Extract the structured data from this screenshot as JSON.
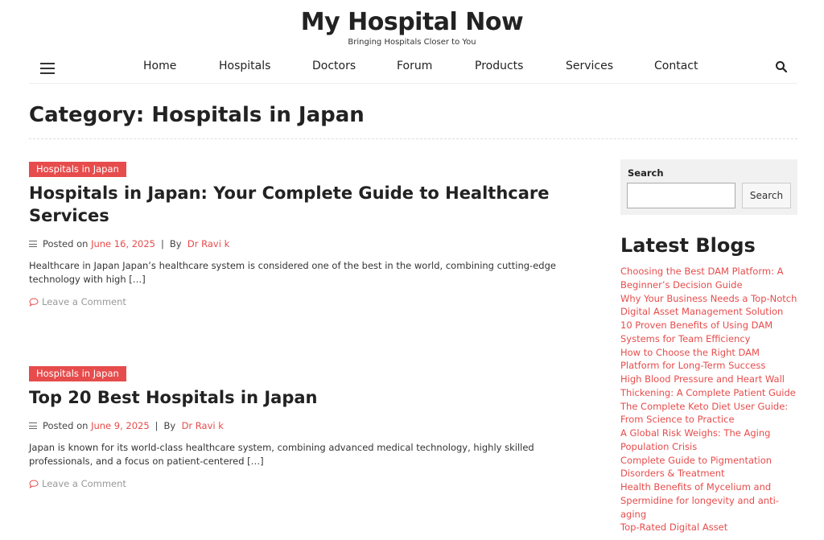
{
  "site": {
    "title": "My Hospital Now",
    "tagline": "Bringing Hospitals Closer to You"
  },
  "nav": {
    "items": [
      {
        "label": "Home"
      },
      {
        "label": "Hospitals"
      },
      {
        "label": "Doctors"
      },
      {
        "label": "Forum"
      },
      {
        "label": "Products"
      },
      {
        "label": "Services"
      },
      {
        "label": "Contact"
      }
    ],
    "menu_icon": "hamburger-icon",
    "search_icon": "search-icon"
  },
  "page": {
    "title": "Category: Hospitals in Japan"
  },
  "posts": [
    {
      "category": "Hospitals in Japan",
      "title": "Hospitals in Japan: Your Complete Guide to Healthcare Services",
      "posted_on_label": "Posted on",
      "date": "June 16, 2025",
      "by_label": "By",
      "author": "Dr Ravi k",
      "excerpt": "Healthcare in Japan Japan’s healthcare system is considered one of the best in the world, combining cutting-edge technology with high […]",
      "comment_label": "Leave a Comment"
    },
    {
      "category": "Hospitals in Japan",
      "title": "Top 20 Best Hospitals in Japan",
      "posted_on_label": "Posted on",
      "date": "June 9, 2025",
      "by_label": "By",
      "author": "Dr Ravi k",
      "excerpt": "Japan is known for its world-class healthcare system, combining advanced medical technology, highly skilled professionals, and a focus on patient-centered […]",
      "comment_label": "Leave a Comment"
    }
  ],
  "sidebar": {
    "search": {
      "label": "Search",
      "button_label": "Search",
      "value": "",
      "placeholder": ""
    },
    "latest_blogs": {
      "heading": "Latest Blogs",
      "items": [
        "Choosing the Best DAM Platform: A Beginner’s Decision Guide",
        "Why Your Business Needs a Top-Notch Digital Asset Management Solution",
        "10 Proven Benefits of Using DAM Systems for Team Efficiency",
        "How to Choose the Right DAM Platform for Long-Term Success",
        "High Blood Pressure and Heart Wall Thickening: A Complete Patient Guide",
        "The Complete Keto Diet User Guide: From Science to Practice",
        "A Global Risk Weighs: The Aging Population Crisis",
        "Complete Guide to Pigmentation Disorders & Treatment",
        "Health Benefits of Mycelium and Spermidine for longevity and anti-aging",
        "Top-Rated Digital Asset"
      ]
    }
  },
  "colors": {
    "accent": "#e74c4c",
    "text": "#222222",
    "muted": "#999999",
    "sidebar_bg": "#f1f1f1"
  }
}
